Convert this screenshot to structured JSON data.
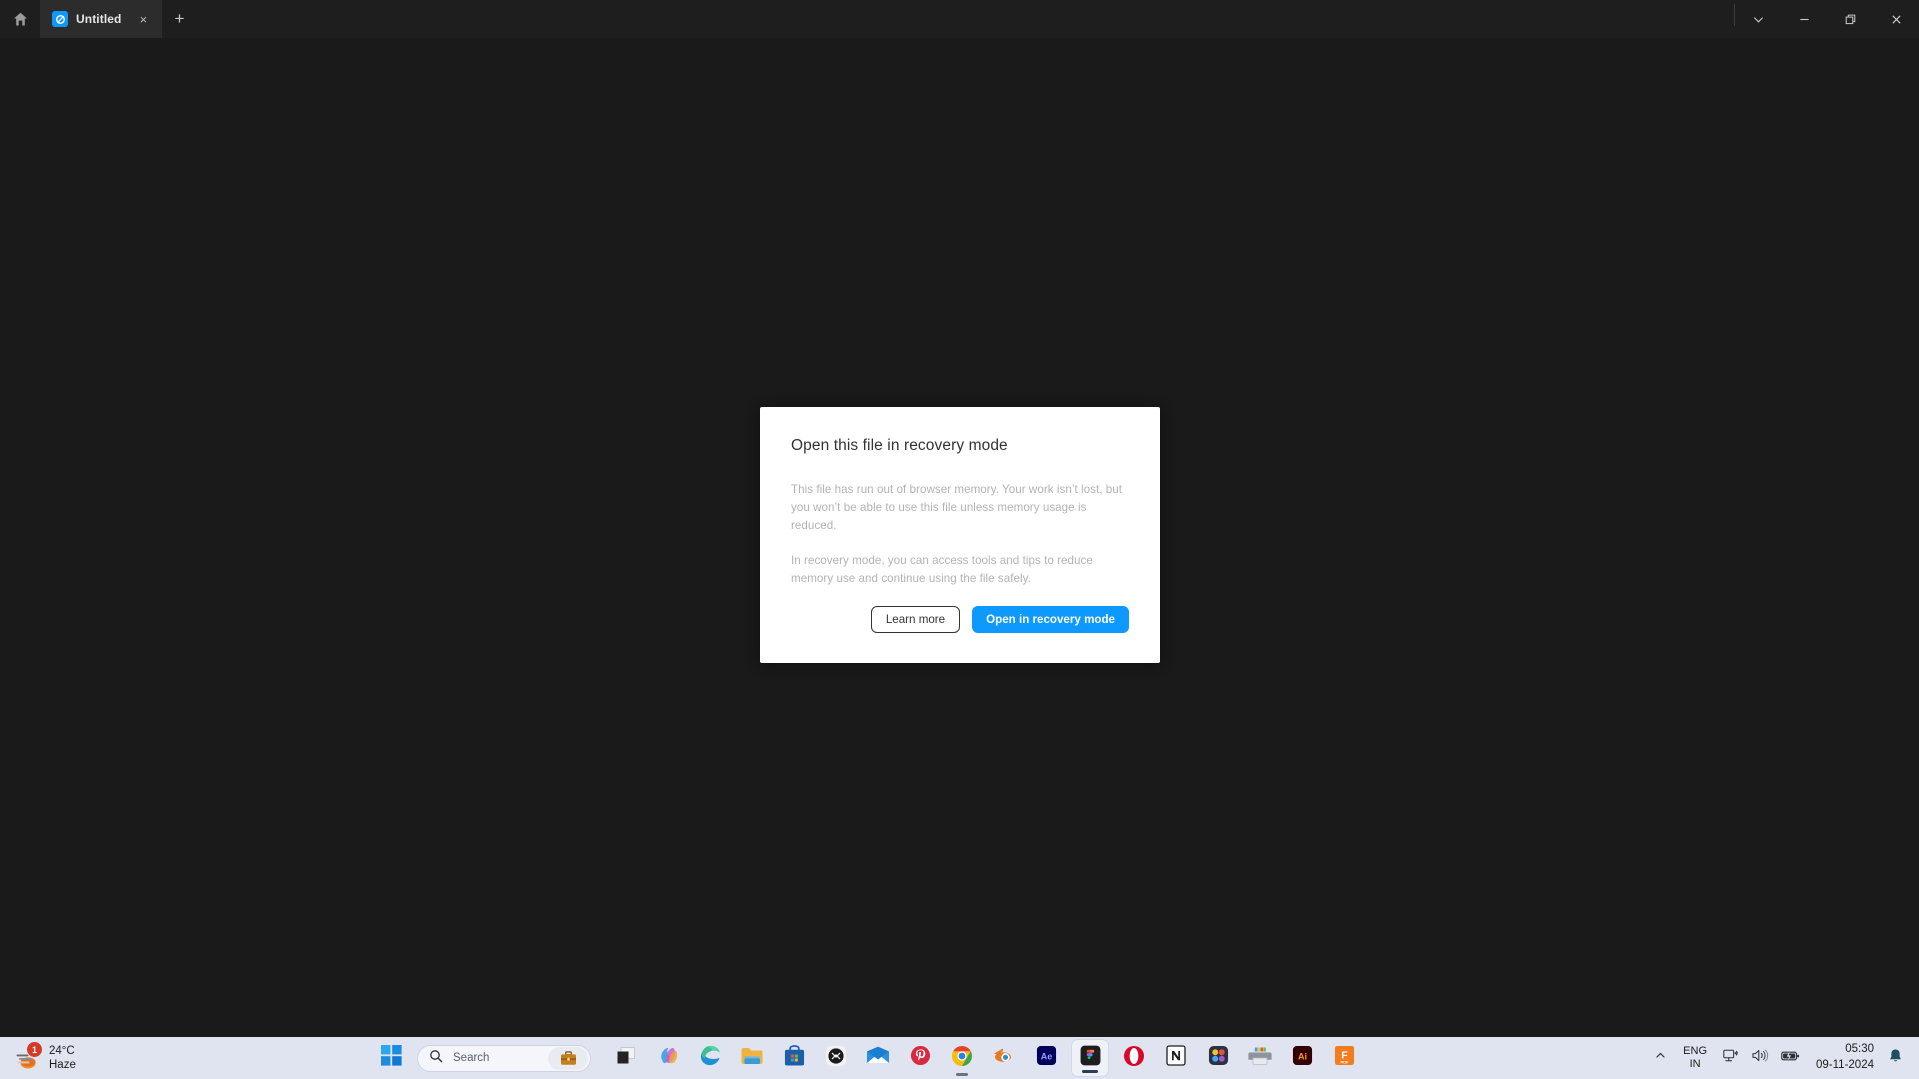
{
  "window": {
    "home_icon": "home-icon",
    "tabs": [
      {
        "title": "Untitled",
        "favicon": "figma-file-icon",
        "close_label": "×"
      }
    ],
    "new_tab_label": "+",
    "controls": [
      {
        "name": "chevron-down-button",
        "label": "chevron-down-icon"
      },
      {
        "name": "minimize-button",
        "label": "minimize-icon"
      },
      {
        "name": "restore-button",
        "label": "restore-icon"
      },
      {
        "name": "close-button",
        "label": "close-icon"
      }
    ]
  },
  "dialog": {
    "title": "Open this file in recovery mode",
    "paragraph1": "This file has run out of browser memory. Your work isn’t lost, but you won’t be able to use this file unless memory usage is reduced.",
    "paragraph2": "In recovery mode, you can access tools and tips to reduce memory use and continue using the file safely.",
    "learn_more_label": "Learn more",
    "open_recovery_label": "Open in recovery mode",
    "accent_color": "#0d99ff",
    "background_color": "#ffffff"
  },
  "taskbar": {
    "weather": {
      "temperature": "24°C",
      "condition": "Haze",
      "badge_count": "1",
      "badge_color": "#d43a28",
      "icon": "haze-icon"
    },
    "start_label": "start-icon",
    "search": {
      "placeholder": "Search",
      "icon": "search-icon",
      "widget_icon": "briefcase-icon"
    },
    "apps": [
      {
        "name": "task-view",
        "icon": "task-view-icon",
        "active": false
      },
      {
        "name": "copilot",
        "icon": "copilot-icon",
        "active": false
      },
      {
        "name": "microsoft-edge",
        "icon": "edge-icon",
        "active": false
      },
      {
        "name": "file-explorer",
        "icon": "folder-icon",
        "active": false
      },
      {
        "name": "microsoft-store",
        "icon": "store-icon",
        "active": false
      },
      {
        "name": "xbox",
        "icon": "xbox-icon",
        "active": false
      },
      {
        "name": "mail",
        "icon": "mail-icon",
        "active": false
      },
      {
        "name": "pinterest",
        "icon": "pinterest-icon",
        "active": false
      },
      {
        "name": "google-chrome",
        "icon": "chrome-icon",
        "active": false,
        "running": true
      },
      {
        "name": "blender",
        "icon": "blender-icon",
        "active": false
      },
      {
        "name": "after-effects",
        "icon": "after-effects-icon",
        "active": false
      },
      {
        "name": "figma",
        "icon": "figma-icon",
        "active": true,
        "running": true
      },
      {
        "name": "opera",
        "icon": "opera-icon",
        "active": false
      },
      {
        "name": "notion",
        "icon": "notion-icon",
        "active": false
      },
      {
        "name": "davinci-resolve",
        "icon": "davinci-resolve-icon",
        "active": false
      },
      {
        "name": "printer",
        "icon": "printer-icon",
        "active": false
      },
      {
        "name": "illustrator",
        "icon": "illustrator-icon",
        "active": false
      },
      {
        "name": "foxit-pdf",
        "icon": "foxit-pdf-icon",
        "active": false
      }
    ],
    "tray": {
      "overflow_label": "show-hidden-icons",
      "language_primary": "ENG",
      "language_secondary": "IN",
      "network_icon": "network-icon",
      "volume_icon": "volume-icon",
      "battery_icon": "battery-icon",
      "time": "05:30",
      "date": "09-11-2024",
      "notification_icon": "bell-icon"
    }
  }
}
